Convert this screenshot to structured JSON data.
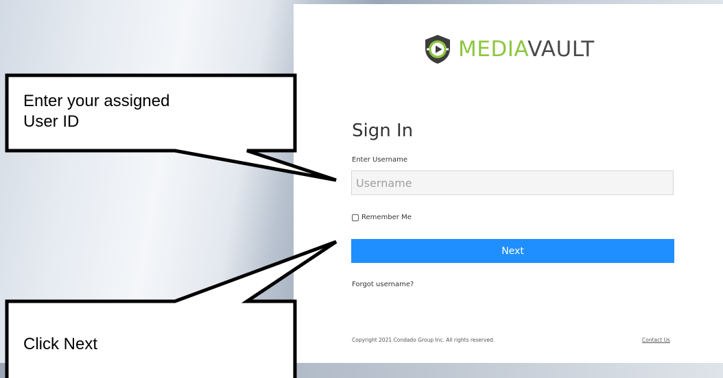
{
  "logo": {
    "brand_part1": "MEDIA",
    "brand_part2": "VAULT",
    "icon": "shield-play-icon",
    "color_media": "#8dc63f",
    "color_vault": "#4a4a4a"
  },
  "signin": {
    "title": "Sign In",
    "username_label": "Enter Username",
    "username_placeholder": "Username",
    "username_value": "",
    "remember_label": "Remember Me",
    "remember_checked": false,
    "next_label": "Next",
    "forgot_label": "Forgot username?",
    "button_color": "#1f8fff"
  },
  "footer": {
    "copyright": "Copyright 2021 Condado Group Inc. All rights reserved.",
    "contact_label": "Contact Us"
  },
  "callouts": {
    "user_id_line1": "Enter your assigned",
    "user_id_line2": "User ID",
    "next_hint": "Click Next"
  }
}
